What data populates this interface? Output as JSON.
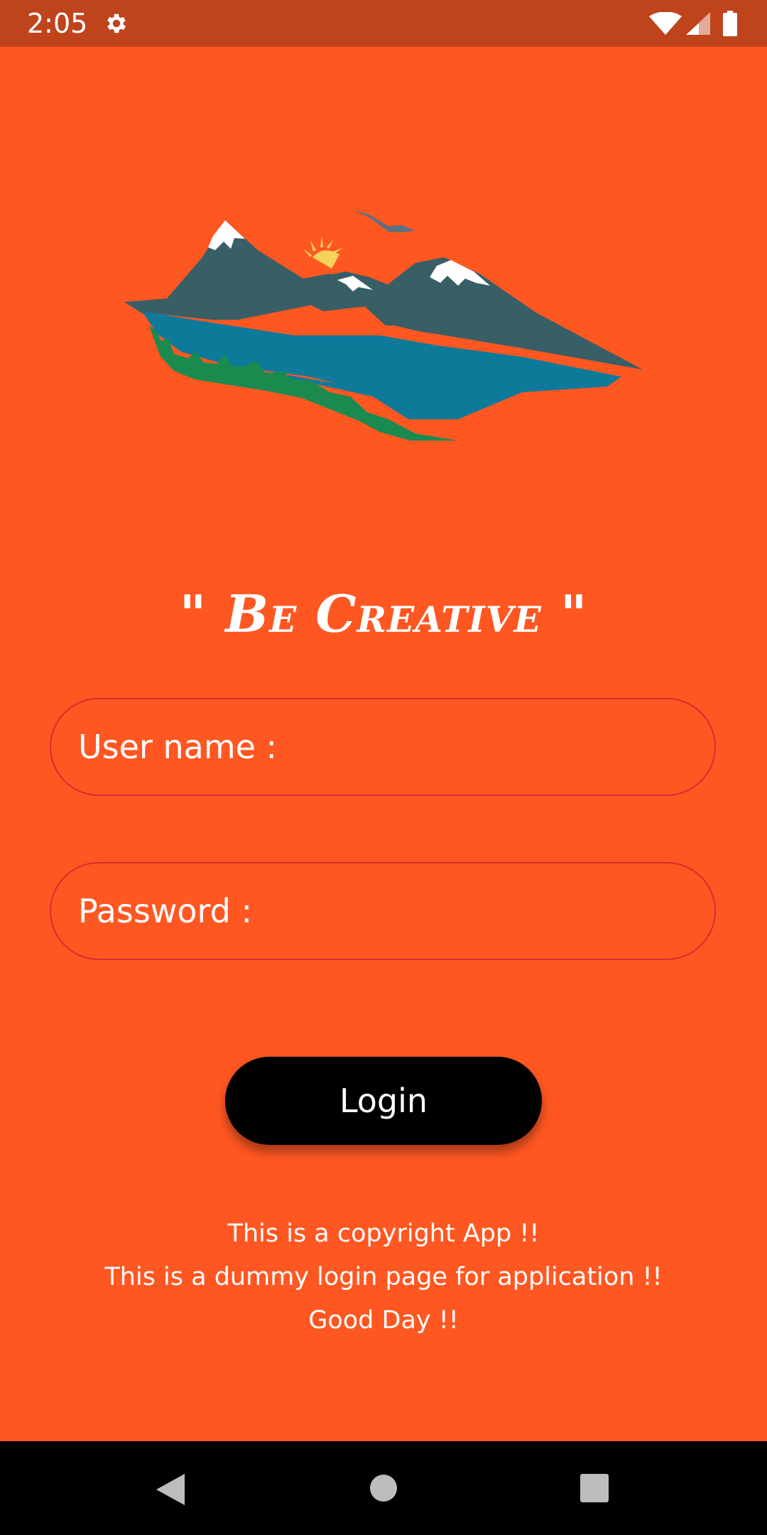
{
  "status_bar": {
    "time": "2:05",
    "icons": [
      "gear-icon",
      "wifi-icon",
      "cell-signal-icon",
      "battery-icon"
    ]
  },
  "logo": {
    "icon": "mountain-landscape-logo"
  },
  "tagline": "\" Be Creative \"",
  "form": {
    "username_placeholder": "User name :",
    "username_value": "",
    "password_placeholder": "Password :",
    "password_value": "",
    "login_label": "Login"
  },
  "footer": {
    "line1": "This is a copyright App !!",
    "line2": "This is a dummy login page for application !!",
    "line3": "Good Day !!"
  },
  "nav_bar": {
    "icons": [
      "back-icon",
      "home-icon",
      "recents-icon"
    ]
  },
  "colors": {
    "background": "#FF5722",
    "status_bar": "#BF441C",
    "field_border": "#D32F2F",
    "button": "#000000",
    "text": "#FFFFFF"
  }
}
